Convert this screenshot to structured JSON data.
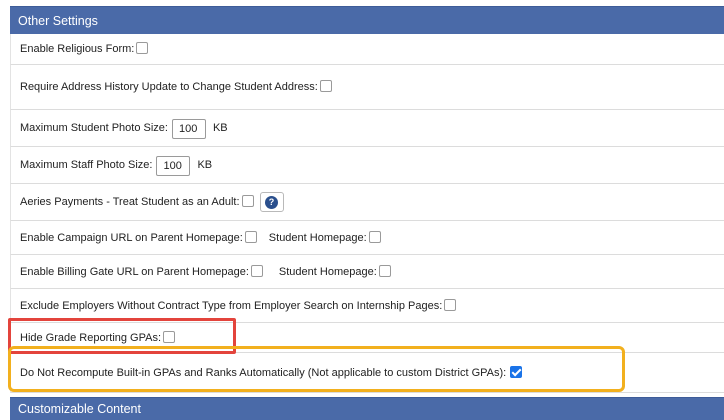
{
  "header": {
    "title": "Other Settings"
  },
  "rows": {
    "religious_form": {
      "label": "Enable Religious Form:"
    },
    "address_history": {
      "label": "Require Address History Update to Change Student Address:"
    },
    "student_photo": {
      "label": "Maximum Student Photo Size:",
      "value": "100",
      "unit": "KB"
    },
    "staff_photo": {
      "label": "Maximum Staff Photo Size:",
      "value": "100",
      "unit": "KB"
    },
    "payments_adult": {
      "label": "Aeries Payments - Treat Student as an Adult:",
      "help_icon": "question-circle-icon"
    },
    "campaign_url": {
      "label": "Enable Campaign URL on Parent Homepage:",
      "label2": "Student Homepage:"
    },
    "billing_gate": {
      "label": "Enable Billing Gate URL on Parent Homepage:",
      "label2": "Student Homepage:"
    },
    "exclude_employers": {
      "label": "Exclude Employers Without Contract Type from Employer Search on Internship Pages:"
    },
    "hide_gpa": {
      "label": "Hide Grade Reporting GPAs:"
    },
    "recompute_gpa": {
      "label": "Do Not Recompute Built-in GPAs and Ranks Automatically (Not applicable to custom District GPAs):",
      "checked": true
    }
  },
  "footer": {
    "title": "Customizable Content"
  },
  "colors": {
    "header_bg": "#4a6aa8",
    "red_highlight": "#e3443c",
    "orange_highlight": "#f2b01e",
    "checkbox_checked": "#1a73e8"
  }
}
